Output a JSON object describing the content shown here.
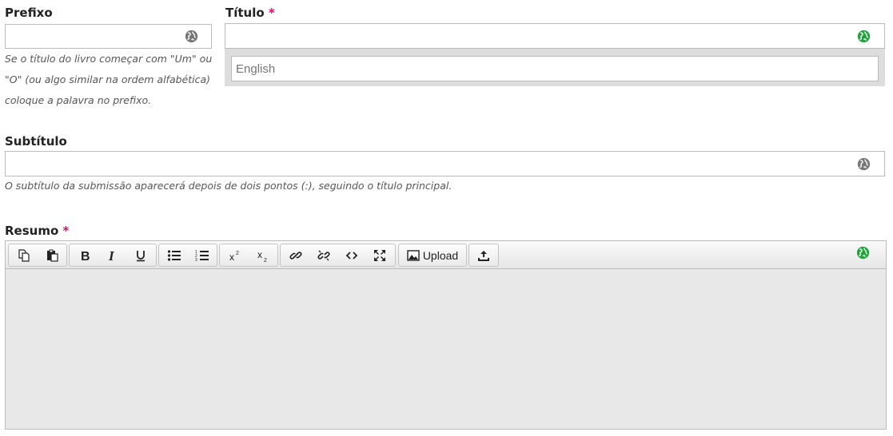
{
  "fields": {
    "prefix": {
      "label": "Prefixo",
      "help": [
        "Se o título do livro começar com \"Um\" ou",
        "\"O\" (ou algo similar na ordem alfabética)",
        "coloque a palavra no prefixo."
      ],
      "globe_icon": "globe-icon"
    },
    "title": {
      "label": "Título",
      "required_mark": "*",
      "globe_icon": "globe-icon-active",
      "language_placeholder": "English"
    },
    "subtitle": {
      "label": "Subtítulo",
      "help": "O subtítulo da submissão aparecerá depois de dois pontos (:), seguindo o título principal.",
      "globe_icon": "globe-icon"
    },
    "abstract": {
      "label": "Resumo",
      "required_mark": "*",
      "globe_icon": "globe-icon-active",
      "toolbar": {
        "upload_label": "Upload",
        "buttons": [
          "copy",
          "paste",
          "bold",
          "italic",
          "underline",
          "bullet-list",
          "numbered-list",
          "superscript",
          "subscript",
          "link",
          "unlink",
          "code",
          "fullscreen",
          "image-upload",
          "upload-file"
        ]
      }
    }
  },
  "colors": {
    "required": "#d00f6a",
    "globe_active": "#1fa53c",
    "globe_inactive": "#777777"
  }
}
